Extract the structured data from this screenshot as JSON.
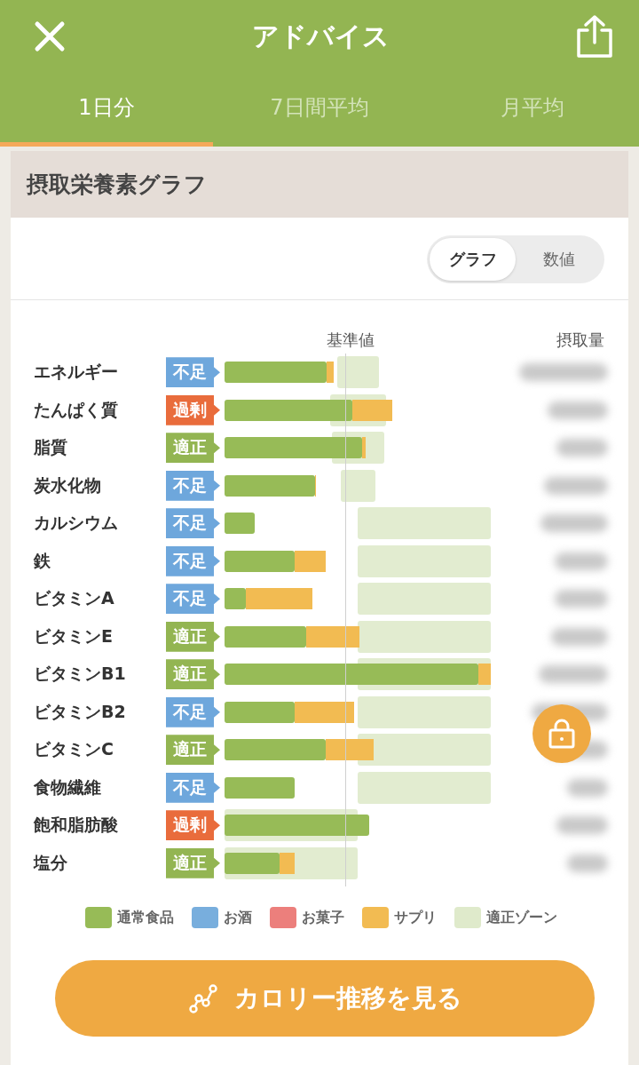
{
  "header": {
    "title": "アドバイス"
  },
  "tabs": [
    {
      "label": "1日分",
      "selected": true
    },
    {
      "label": "7日間平均",
      "selected": false
    },
    {
      "label": "月平均",
      "selected": false
    }
  ],
  "card": {
    "title": "摂取栄養素グラフ",
    "view_toggle": [
      {
        "label": "グラフ",
        "selected": true
      },
      {
        "label": "数値",
        "selected": false
      }
    ],
    "column_headers": {
      "reference": "基準値",
      "intake": "摂取量"
    },
    "nutrients": [
      {
        "name": "エネルギー",
        "status": "不足",
        "kind": "short"
      },
      {
        "name": "たんぱく質",
        "status": "過剰",
        "kind": "over"
      },
      {
        "name": "脂質",
        "status": "適正",
        "kind": "ok"
      },
      {
        "name": "炭水化物",
        "status": "不足",
        "kind": "short"
      },
      {
        "name": "カルシウム",
        "status": "不足",
        "kind": "short"
      },
      {
        "name": "鉄",
        "status": "不足",
        "kind": "short"
      },
      {
        "name": "ビタミンA",
        "status": "不足",
        "kind": "short"
      },
      {
        "name": "ビタミンE",
        "status": "適正",
        "kind": "ok"
      },
      {
        "name": "ビタミンB1",
        "status": "適正",
        "kind": "ok"
      },
      {
        "name": "ビタミンB2",
        "status": "不足",
        "kind": "short"
      },
      {
        "name": "ビタミンC",
        "status": "適正",
        "kind": "ok"
      },
      {
        "name": "食物繊維",
        "status": "不足",
        "kind": "short"
      },
      {
        "name": "飽和脂肪酸",
        "status": "過剰",
        "kind": "over"
      },
      {
        "name": "塩分",
        "status": "適正",
        "kind": "ok"
      }
    ],
    "legend": [
      {
        "label": "通常食品",
        "color": "#97bb57"
      },
      {
        "label": "お酒",
        "color": "#78aedd"
      },
      {
        "label": "お菓子",
        "color": "#ec7f7c"
      },
      {
        "label": "サプリ",
        "color": "#f2bb52"
      },
      {
        "label": "適正ゾーン",
        "color": "#dfeacb"
      }
    ],
    "action_button": {
      "label": "カロリー推移を見る"
    }
  }
}
